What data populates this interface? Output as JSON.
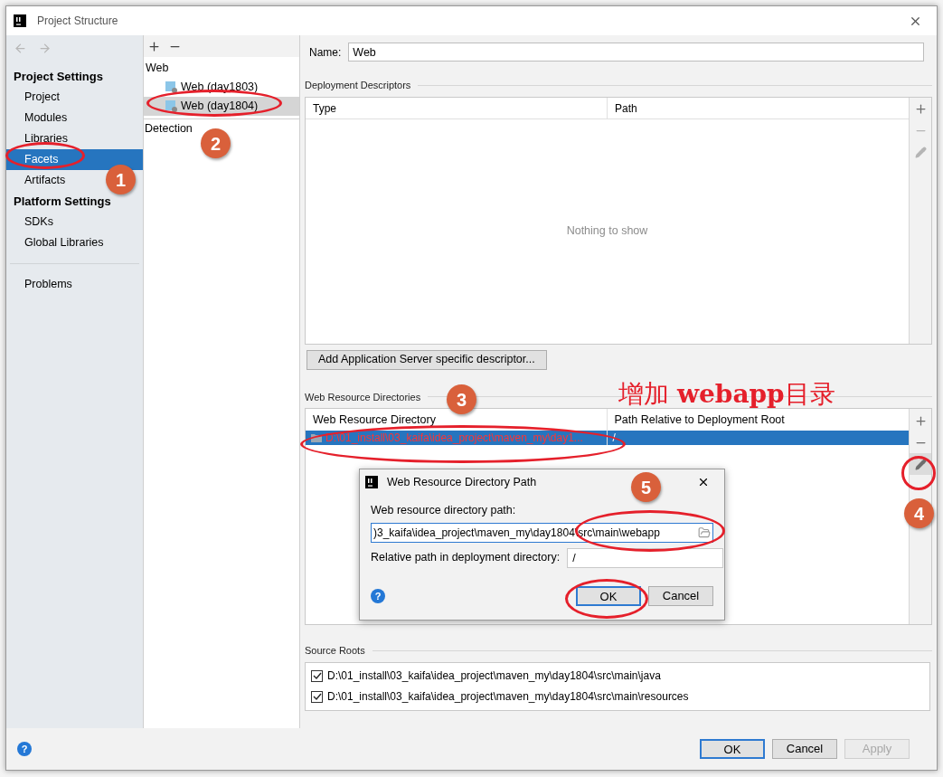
{
  "window": {
    "title": "Project Structure"
  },
  "sidebar": {
    "sections": [
      {
        "heading": "Project Settings",
        "items": [
          {
            "label": "Project",
            "selected": false
          },
          {
            "label": "Modules",
            "selected": false
          },
          {
            "label": "Libraries",
            "selected": false
          },
          {
            "label": "Facets",
            "selected": true
          },
          {
            "label": "Artifacts",
            "selected": false
          }
        ]
      },
      {
        "heading": "Platform Settings",
        "items": [
          {
            "label": "SDKs",
            "selected": false
          },
          {
            "label": "Global Libraries",
            "selected": false
          }
        ]
      }
    ],
    "footer_items": [
      {
        "label": "Problems",
        "selected": false
      }
    ]
  },
  "facet_tree": {
    "groups": [
      {
        "label": "Web",
        "children": [
          {
            "label": "Web (day1803)",
            "selected": false
          },
          {
            "label": "Web (day1804)",
            "selected": true
          }
        ]
      }
    ],
    "detection": "Detection"
  },
  "details": {
    "name_label": "Name:",
    "name_value": "Web",
    "deployment_descriptors": {
      "title": "Deployment Descriptors",
      "columns": [
        "Type",
        "Path"
      ],
      "empty_text": "Nothing to show",
      "toolbar": [
        {
          "kind": "add",
          "disabled": false
        },
        {
          "kind": "remove",
          "disabled": true
        },
        {
          "kind": "edit",
          "disabled": true
        }
      ]
    },
    "add_button": "Add Application Server specific descriptor...",
    "web_resources": {
      "title": "Web Resource Directories",
      "columns": [
        "Web Resource Directory",
        "Path Relative to Deployment Root"
      ],
      "rows": [
        {
          "cells": [
            "D:\\01_install\\03_kaifa\\idea_project\\maven_my\\day1...",
            "/"
          ],
          "selected": true
        }
      ],
      "toolbar": [
        {
          "kind": "add",
          "disabled": false
        },
        {
          "kind": "remove",
          "disabled": false
        },
        {
          "kind": "edit",
          "disabled": false
        }
      ]
    },
    "source_roots": {
      "title": "Source Roots",
      "items": [
        {
          "path": "D:\\01_install\\03_kaifa\\idea_project\\maven_my\\day1804\\src\\main\\java",
          "checked": true
        },
        {
          "path": "D:\\01_install\\03_kaifa\\idea_project\\maven_my\\day1804\\src\\main\\resources",
          "checked": true
        }
      ]
    }
  },
  "dialog": {
    "title": "Web Resource Directory Path",
    "path_label": "Web resource directory path:",
    "path_value": ")3_kaifa\\idea_project\\maven_my\\day1804\\src\\main\\webapp",
    "relative_label": "Relative path in deployment directory:",
    "relative_value": "/",
    "help": "?",
    "buttons": [
      {
        "label": "OK",
        "default": true,
        "disabled": false
      },
      {
        "label": "Cancel",
        "default": false,
        "disabled": false
      }
    ]
  },
  "help": "?",
  "buttons": [
    {
      "label": "OK",
      "default": true,
      "disabled": false
    },
    {
      "label": "Cancel",
      "default": false,
      "disabled": false
    },
    {
      "label": "Apply",
      "default": false,
      "disabled": true
    }
  ],
  "annotations": {
    "note": "增加 **webapp**目录",
    "badges": [
      "1",
      "2",
      "3",
      "4",
      "5"
    ]
  }
}
